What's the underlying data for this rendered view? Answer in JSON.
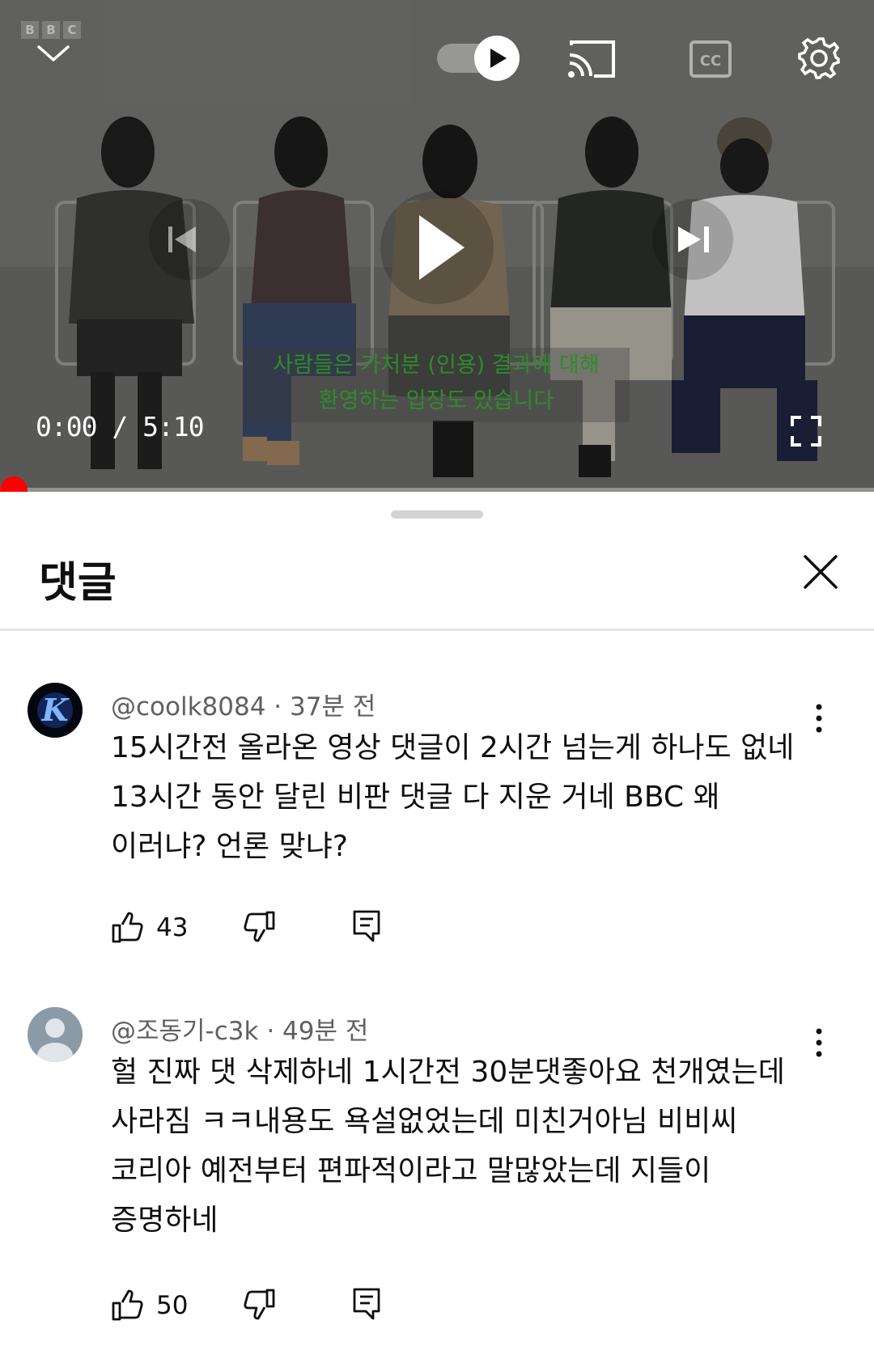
{
  "player": {
    "watermark": [
      "B",
      "B",
      "C"
    ],
    "time_current": "0:00",
    "time_total": "5:10",
    "caption_lines": [
      "사람들은 가처분 (인용) 결과에 대해",
      "환영하는 입장도 있습니다"
    ],
    "progress_fraction": 0.0,
    "accent_color": "#ff0000",
    "icons": [
      "chevron-down-icon",
      "autoplay-toggle",
      "cast-icon",
      "cc-icon",
      "settings-gear-icon",
      "previous-icon",
      "play-icon",
      "next-icon",
      "fullscreen-icon"
    ]
  },
  "sheet": {
    "title": "댓글",
    "close_icon": "close-icon"
  },
  "comments": [
    {
      "author": "@coolk8084",
      "age": "37분 전",
      "text": [
        "15시간전 올라온 영상 댓글이 2시간 넘는게 하나도 없네",
        "13시간 동안 달린 비판 댓글 다 지운 거네 BBC 왜",
        "이러냐? 언론 맞냐?"
      ],
      "likes": "43"
    },
    {
      "author": "@조동기-c3k",
      "age": "49분 전",
      "text": [
        "헐 진짜 댓 삭제하네 1시간전 30분댓좋아요 천개였는데",
        "사라짐 ㅋㅋ내용도 욕설없었는데  미친거아님 비비씨",
        "코리아 예전부터 편파적이라고 말많았는데 지들이",
        "증명하네"
      ],
      "likes": "50"
    }
  ]
}
